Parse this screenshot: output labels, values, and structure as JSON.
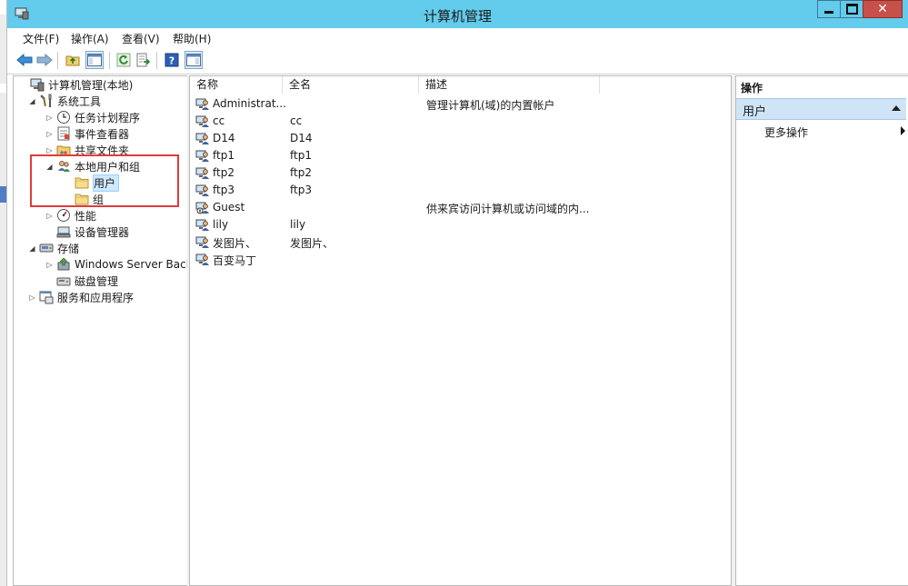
{
  "window": {
    "title": "计算机管理"
  },
  "menu": [
    "文件(F)",
    "操作(A)",
    "查看(V)",
    "帮助(H)"
  ],
  "toolbar": {
    "items": [
      "back-icon",
      "forward-icon",
      "up-folder-icon",
      "show-hide-tree-icon",
      "refresh-icon",
      "export-list-icon",
      "help-icon",
      "action-pane-icon"
    ]
  },
  "tree": [
    {
      "label": "计算机管理(本地)",
      "level": 0,
      "expander": "",
      "icon": "computer-management-icon"
    },
    {
      "label": "系统工具",
      "level": 1,
      "expander": "◢",
      "icon": "system-tools-icon"
    },
    {
      "label": "任务计划程序",
      "level": 2,
      "expander": "▷",
      "icon": "task-scheduler-icon"
    },
    {
      "label": "事件查看器",
      "level": 2,
      "expander": "▷",
      "icon": "event-viewer-icon"
    },
    {
      "label": "共享文件夹",
      "level": 2,
      "expander": "▷",
      "icon": "shared-folders-icon"
    },
    {
      "label": "本地用户和组",
      "level": 2,
      "expander": "◢",
      "icon": "local-users-groups-icon"
    },
    {
      "label": "用户",
      "level": 3,
      "expander": "",
      "icon": "folder-icon",
      "selected": true
    },
    {
      "label": "组",
      "level": 3,
      "expander": "",
      "icon": "folder-icon"
    },
    {
      "label": "性能",
      "level": 2,
      "expander": "▷",
      "icon": "performance-icon"
    },
    {
      "label": "设备管理器",
      "level": 2,
      "expander": "",
      "icon": "device-manager-icon"
    },
    {
      "label": "存储",
      "level": 1,
      "expander": "◢",
      "icon": "storage-icon"
    },
    {
      "label": "Windows Server Back",
      "level": 2,
      "expander": "▷",
      "icon": "windows-server-backup-icon"
    },
    {
      "label": "磁盘管理",
      "level": 2,
      "expander": "",
      "icon": "disk-management-icon"
    },
    {
      "label": "服务和应用程序",
      "level": 1,
      "expander": "▷",
      "icon": "services-applications-icon"
    }
  ],
  "list": {
    "columns": [
      "名称",
      "全名",
      "描述"
    ],
    "rows": [
      {
        "name": "Administrat...",
        "fullname": "",
        "desc": "管理计算机(域)的内置帐户"
      },
      {
        "name": "cc",
        "fullname": "cc",
        "desc": ""
      },
      {
        "name": "D14",
        "fullname": "D14",
        "desc": ""
      },
      {
        "name": "ftp1",
        "fullname": "ftp1",
        "desc": ""
      },
      {
        "name": "ftp2",
        "fullname": "ftp2",
        "desc": ""
      },
      {
        "name": "ftp3",
        "fullname": "ftp3",
        "desc": ""
      },
      {
        "name": "Guest",
        "fullname": "",
        "desc": "供来宾访问计算机或访问域的内..."
      },
      {
        "name": "lily",
        "fullname": "lily",
        "desc": ""
      },
      {
        "name": "发图片、",
        "fullname": "发图片、",
        "desc": ""
      },
      {
        "name": "百变马丁",
        "fullname": "",
        "desc": ""
      }
    ]
  },
  "actions": {
    "title": "操作",
    "group": "用户",
    "more": "更多操作"
  },
  "colors": {
    "titlebar": "#63cbeb",
    "close": "#c7504b",
    "selection": "#cde8ff",
    "highlight": "#e03b3b"
  }
}
